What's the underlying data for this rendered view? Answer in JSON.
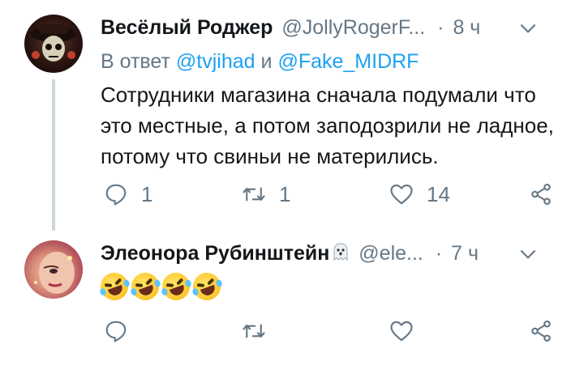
{
  "tweets": [
    {
      "author_name": "Весёлый Роджер",
      "handle": "@JollyRogerF...",
      "dot": "·",
      "time": "8 ч",
      "reply_prefix": "В ответ",
      "reply_user1": "@tvjihad",
      "reply_and": "и",
      "reply_user2": "@Fake_MIDRF",
      "text": "Сотрудники магазина сначала подумали что это местные, а потом заподозрили не ладное, потому что свиньи не матерились.",
      "reply_count": "1",
      "retweet_count": "1",
      "like_count": "14"
    },
    {
      "author_name": "Элеонора Рубинштейн",
      "handle": "@ele...",
      "dot": "·",
      "time": "7 ч",
      "emoji_count": 4,
      "reply_count": "",
      "retweet_count": "",
      "like_count": ""
    }
  ],
  "icons": {
    "reply": "reply-icon",
    "retweet": "retweet-icon",
    "like": "heart-icon",
    "share": "share-icon",
    "menu": "chevron-down-icon",
    "name_badge": "ghost-icon",
    "emoji": "rolling-on-floor-laughing-emoji"
  },
  "colors": {
    "text": "#14171a",
    "secondary": "#657786",
    "link": "#1da1f2",
    "thread_line": "#ccd6dd"
  }
}
